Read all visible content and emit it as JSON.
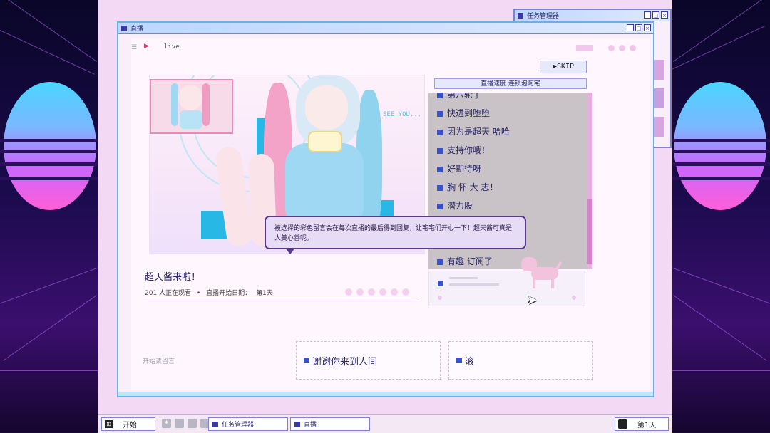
{
  "taskmgr_window": {
    "title": "任务管理器"
  },
  "stream_window": {
    "title": "直播"
  },
  "live": {
    "label": "live",
    "arrow": "▶",
    "menu": "☰"
  },
  "skip_button": {
    "label": "▶SKIP"
  },
  "chat": {
    "title": "直播速度 连锁泡阿宅",
    "messages": [
      "第六轮了",
      "快进到堕堕",
      "因为是超天 哈哈",
      "支持你哦！",
      "好期待呀",
      "胸 怀 大 志！",
      "潜力股",
      "有趣 订阅了"
    ]
  },
  "stream": {
    "see_you": "SEE YOU...",
    "title": "超天酱来啦！",
    "viewers": "201 人正在观看",
    "separator": "•",
    "start_date_label": "直播开始日期：",
    "start_date_value": "第1天"
  },
  "tooltip": {
    "text": "被选择的彩色留言会在每次直播的最后得到回复，让宅宅们开心一下！超天酱可真是人美心善呢。"
  },
  "reply": {
    "label": "开始读留言",
    "option1": "谢谢你来到人间",
    "option2": "滚"
  },
  "taskbar": {
    "start_label": "开始",
    "start_icon": "⊞",
    "task1": "任务管理器",
    "task2": "直播",
    "day_label": "第1天"
  },
  "colors": {
    "accent": "#3a52c9",
    "window_border": "#7a82d8",
    "panel_bg": "#fff7fd",
    "tooltip_border": "#5a3a8c"
  }
}
